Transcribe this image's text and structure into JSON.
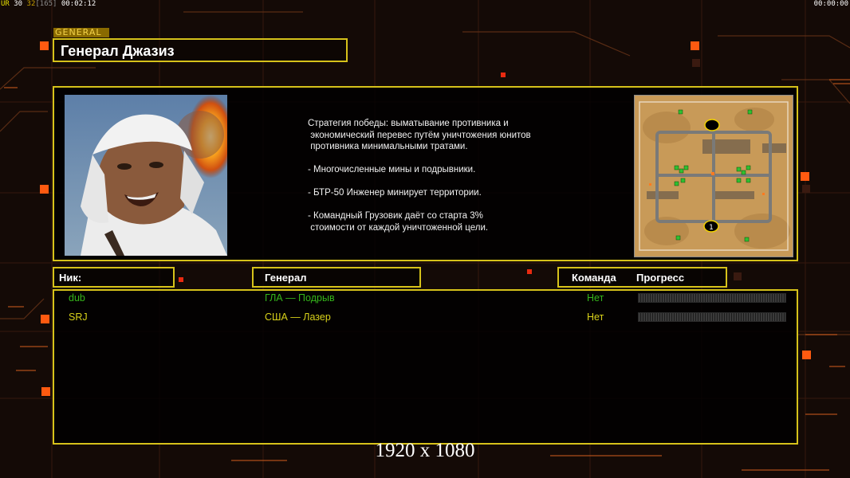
{
  "hud": {
    "left_a": "UR",
    "left_b": "30",
    "left_c": "32",
    "left_d": "[165]",
    "left_time": "00:02:12",
    "right_time": "00:00:00"
  },
  "header": {
    "tag": "GENERAL",
    "title": "Генерал Джазиз"
  },
  "info": {
    "strategy_text": "Стратегия победы: выматывание противника и\n экономический перевес путём уничтожения юнитов\n противника минимальными тратами.\n\n- Многочисленные мины и подрывники.\n\n- БТР-50 Инженер минирует территории.\n\n- Командный Грузовик даёт со старта 3%\n стоимости от каждой уничтоженной цели.",
    "minimap_markers": [
      "1"
    ]
  },
  "columns": {
    "nick": "Ник:",
    "general": "Генерал",
    "team": "Команда",
    "progress": "Прогресс"
  },
  "players": [
    {
      "nick": "dub",
      "general": "ГЛА — Подрыв",
      "team": "Нет",
      "color": "#35b51b",
      "progress": 0
    },
    {
      "nick": "SRJ",
      "general": "США — Лазер",
      "team": "Нет",
      "color": "#d9d21a",
      "progress": 0
    }
  ],
  "footer": {
    "resolution": "1920 x 1080"
  },
  "colors": {
    "accent": "#d6c21a",
    "hot_orange": "#ff5a10"
  }
}
